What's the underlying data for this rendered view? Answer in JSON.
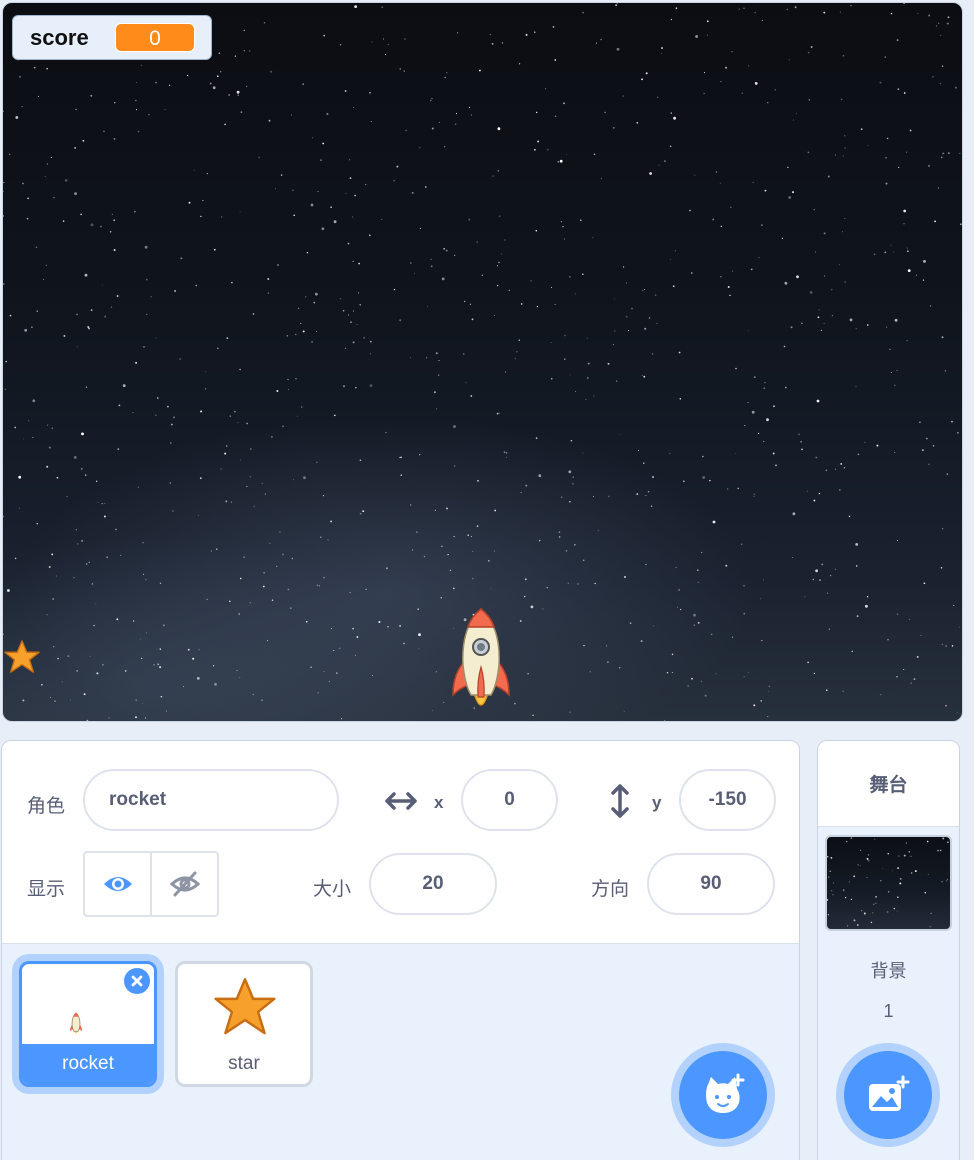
{
  "stage": {
    "monitor": {
      "label": "score",
      "value": "0"
    }
  },
  "sprite_info": {
    "sprite_label": "角色",
    "sprite_name": "rocket",
    "x_label": "x",
    "x_value": "0",
    "y_label": "y",
    "y_value": "-150",
    "show_label": "显示",
    "size_label": "大小",
    "size_value": "20",
    "direction_label": "方向",
    "direction_value": "90"
  },
  "sprites": [
    {
      "name": "rocket",
      "selected": true
    },
    {
      "name": "star",
      "selected": false
    }
  ],
  "stage_selector": {
    "title": "舞台",
    "backdrops_label": "背景",
    "backdrops_count": "1"
  },
  "colors": {
    "accent": "#4c97ff",
    "monitor_value_bg": "#ff8c1a",
    "text": "#575e75"
  },
  "icons": [
    "horizontal-arrow-icon",
    "vertical-arrow-icon",
    "eye-icon",
    "eye-slash-icon",
    "close-icon",
    "add-sprite-cat-icon",
    "add-backdrop-icon"
  ]
}
